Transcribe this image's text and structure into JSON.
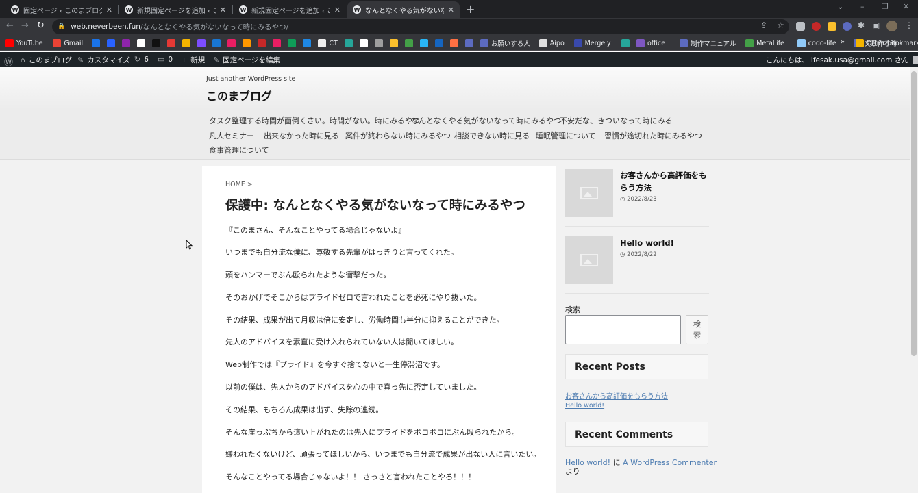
{
  "browser": {
    "tabs": [
      {
        "title": "固定ページ ‹ このまブログ — WordPr",
        "active": false
      },
      {
        "title": "新規固定ページを追加 ‹ このまブログ",
        "active": false
      },
      {
        "title": "新規固定ページを追加 ‹ このまブログ",
        "active": false
      },
      {
        "title": "なんとなくやる気がないなって時にみるや",
        "active": true
      }
    ],
    "tab_icon": "W",
    "close_glyph": "✕",
    "new_tab_glyph": "+",
    "url_host": "web.neverbeen.fun",
    "url_path": "/なんとなくやる気がないなって時にみるやつ/",
    "bookmarks": [
      {
        "label": "YouTube",
        "color": "#ff0000"
      },
      {
        "label": "Gmail",
        "color": "#ea4335"
      },
      {
        "label": "",
        "color": "#1a73e8"
      },
      {
        "label": "",
        "color": "#2962ff"
      },
      {
        "label": "",
        "color": "#8e24aa"
      },
      {
        "label": "",
        "color": "#ffffff"
      },
      {
        "label": "",
        "color": "#111111"
      },
      {
        "label": "",
        "color": "#e53935"
      },
      {
        "label": "",
        "color": "#f4b400"
      },
      {
        "label": "",
        "color": "#7c4dff"
      },
      {
        "label": "",
        "color": "#1976d2"
      },
      {
        "label": "",
        "color": "#e91e63"
      },
      {
        "label": "",
        "color": "#ff9800"
      },
      {
        "label": "",
        "color": "#c62828"
      },
      {
        "label": "",
        "color": "#e91e63"
      },
      {
        "label": "",
        "color": "#0f9d58"
      },
      {
        "label": "",
        "color": "#1e88e5"
      },
      {
        "label": "CT",
        "color": "#eeeeee"
      },
      {
        "label": "",
        "color": "#26a69a"
      },
      {
        "label": "",
        "color": "#ffffff"
      },
      {
        "label": "",
        "color": "#9e9e9e"
      },
      {
        "label": "",
        "color": "#fbc02d"
      },
      {
        "label": "",
        "color": "#43a047"
      },
      {
        "label": "",
        "color": "#29b6f6"
      },
      {
        "label": "",
        "color": "#1565c0"
      },
      {
        "label": "",
        "color": "#ff7043"
      },
      {
        "label": "",
        "color": "#5c6bc0"
      },
      {
        "label": "お願いする人",
        "color": "#5c6bc0"
      },
      {
        "label": "Aipo",
        "color": "#e0e0e0"
      },
      {
        "label": "Mergely",
        "color": "#3949ab"
      },
      {
        "label": "",
        "color": "#26a69a"
      },
      {
        "label": "office",
        "color": "#7e57c2"
      },
      {
        "label": "制作マニュアル",
        "color": "#5c6bc0"
      },
      {
        "label": "MetaLife",
        "color": "#43a047"
      },
      {
        "label": "codo-life",
        "color": "#90caf9"
      },
      {
        "label": "文章作る時",
        "color": "#5c6bc0"
      }
    ],
    "bookmarks_more": "»",
    "other_bookmarks": "Other bookmarks"
  },
  "adminbar": {
    "site_name": "このまブログ",
    "customize": "カスタマイズ",
    "updates": "6",
    "comments": "0",
    "new": "新規",
    "edit": "固定ページを編集",
    "greeting": "こんにちは、lifesak.usa@gmail.com さん"
  },
  "site": {
    "tagline": "Just another WordPress site",
    "title": "このまブログ",
    "menu": [
      "タスク整理する時間が面倒くさい。時間がない。時にみるやつ",
      "なんとなくやる気がないなって時にみるやつ",
      "不安だな、きついなって時にみる",
      "凡人セミナー",
      "出来なかった時に見る",
      "案件が終わらない時にみるやつ",
      "相談できない時に見る",
      "睡眠管理について",
      "習慣が途切れた時にみるやつ",
      "食事管理について"
    ]
  },
  "article": {
    "breadcrumb": "HOME >",
    "title": "保護中: なんとなくやる気がないなって時にみるやつ",
    "paragraphs": [
      "『このまさん、そんなことやってる場合じゃないよ』",
      "いつまでも自分流な僕に、尊敬する先輩がはっきりと言ってくれた。",
      "頭をハンマーでぶん殴られたような衝撃だった。",
      "そのおかげでそこからはプライドゼロで言われたことを必死にやり抜いた。",
      "その結果、成果が出て月収は倍に安定し、労働時間も半分に抑えることができた。",
      "先人のアドバイスを素直に受け入れられていない人は聞いてほしい。",
      "Web制作では『プライド』を今すぐ捨てないと一生停滞沼です。",
      "以前の僕は、先人からのアドバイスを心の中で真っ先に否定していました。",
      "その結果、もちろん成果は出ず、失踪の連続。",
      "そんな崖っぷちから這い上がれたのは先人にプライドをボコボコにぶん殴られたから。",
      "嫌われたくないけど、頑張ってほしいから、いつまでも自分流で成果が出ない人に言いたい。",
      "そんなことやってる場合じゃないよ！！ さっさと言われたことやろ！！！"
    ]
  },
  "sidebar": {
    "popular": [
      {
        "title": "お客さんから高評価をもらう方法",
        "date": "2022/8/23"
      },
      {
        "title": "Hello world!",
        "date": "2022/8/22"
      }
    ],
    "search_label": "検索",
    "search_button": "検索",
    "recent_posts_title": "Recent Posts",
    "recent_posts": [
      "お客さんから高評価をもらう方法",
      "Hello world!"
    ],
    "recent_comments_title": "Recent Comments",
    "comment": {
      "post": "Hello world!",
      "ni": "に",
      "author": "A WordPress Commenter",
      "yori": "より"
    }
  }
}
